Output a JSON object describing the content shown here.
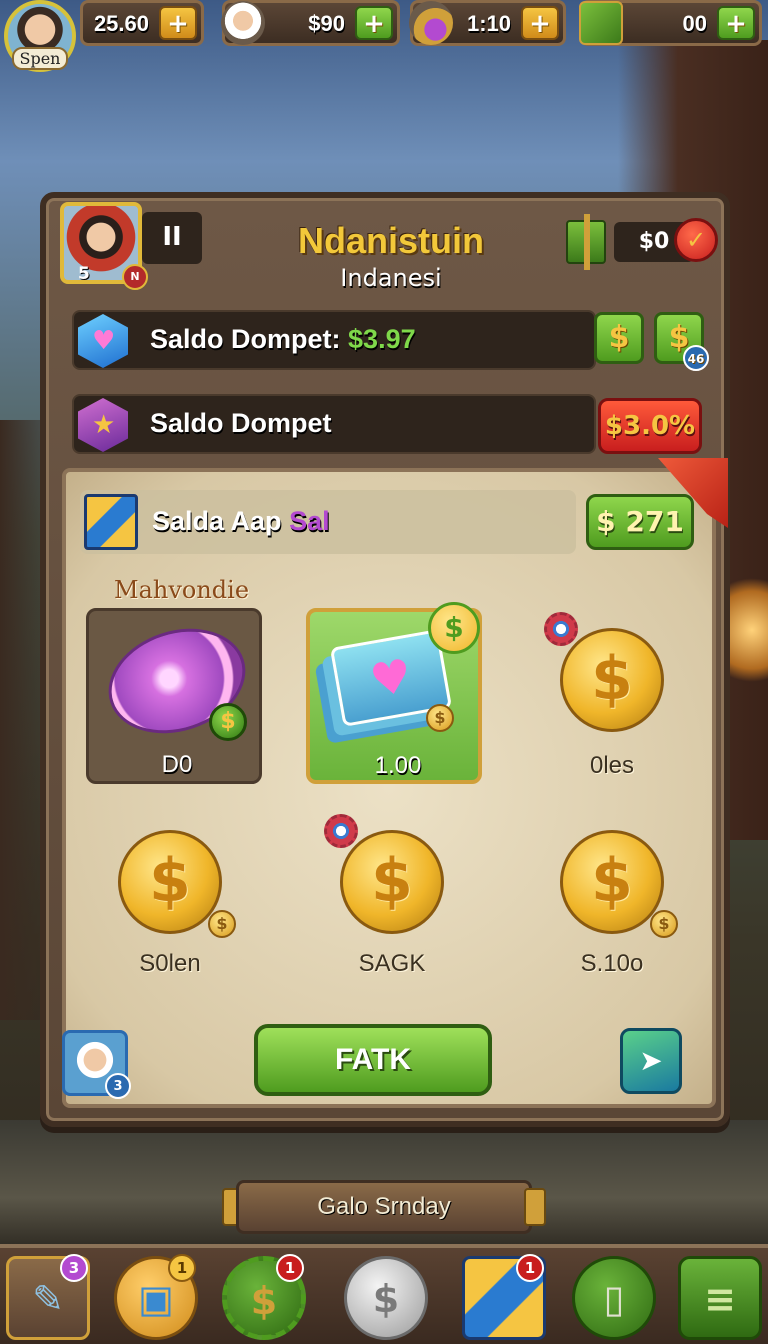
{
  "topbar": {
    "player_label": "Spen",
    "resources": [
      {
        "value": "25.60",
        "icon": "coin-stack-icon",
        "button": "+"
      },
      {
        "value": "$90",
        "icon": "chef-icon",
        "button": "+"
      },
      {
        "value": "1:10",
        "icon": "turnip-icon",
        "button": "+"
      },
      {
        "value": "00",
        "icon": "gift-box-icon",
        "button": "+"
      }
    ]
  },
  "panel": {
    "level": "5",
    "badge": "N",
    "pause": "II",
    "title": "Ndanistuin",
    "subtitle": "Indanesi",
    "balance": "$0",
    "close": "✓",
    "rows": [
      {
        "label": "Saldo Dompet:",
        "value": "$3.97",
        "btn1": "$",
        "btn2": "$",
        "btn2_badge": "46"
      },
      {
        "label": "Saldo Dompet",
        "badge_value": "$3.0%"
      }
    ],
    "shop": {
      "ribbon_label": "Salda Aap",
      "ribbon_tag": "Sal",
      "ribbon_value": "$ 271",
      "section_title": "Mahvondie",
      "items": [
        {
          "name": "D0",
          "icon": "pink-disc-icon"
        },
        {
          "name": "1.00",
          "icon": "heart-cards-icon"
        },
        {
          "name": "0les",
          "icon": "gold-coin-icon"
        },
        {
          "name": "S0len",
          "icon": "gold-coin-icon"
        },
        {
          "name": "SAGK",
          "icon": "gold-coin-icon"
        },
        {
          "name": "S.10o",
          "icon": "gold-coin-icon"
        }
      ],
      "chef_badge": "3",
      "action_button": "FATK",
      "share": "➤"
    }
  },
  "banner": {
    "label": "Galo Srnday"
  },
  "nav": [
    {
      "icon": "quill-icon",
      "badge": "3"
    },
    {
      "icon": "ticket-icon",
      "badge": "1"
    },
    {
      "icon": "dollar-gear-icon",
      "badge": "1"
    },
    {
      "icon": "silver-coin-icon",
      "badge": ""
    },
    {
      "icon": "crate-icon",
      "badge": "1"
    },
    {
      "icon": "phone-icon",
      "badge": ""
    },
    {
      "icon": "menu-icon",
      "badge": ""
    }
  ],
  "colors": {
    "accent_gold": "#f2c83a",
    "button_green": "#4f9c1f",
    "danger_red": "#c81e1e",
    "wood": "#5a4636"
  }
}
